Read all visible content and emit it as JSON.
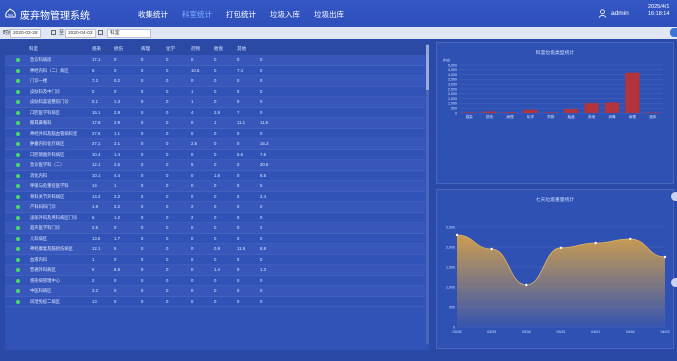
{
  "header": {
    "app_title": "废弃物管理系统",
    "nav": [
      {
        "label": "收集统计",
        "active": false
      },
      {
        "label": "科室统计",
        "active": true
      },
      {
        "label": "打包统计",
        "active": false
      },
      {
        "label": "垃圾入库",
        "active": false
      },
      {
        "label": "垃圾出库",
        "active": false
      }
    ],
    "user": "admin",
    "date": "2025/4/1",
    "time": "16:18:14"
  },
  "filter": {
    "label": "时间:",
    "start_date": "2020-03-28",
    "separator": "至",
    "end_date": "2020-04-03",
    "dept_select": "科室"
  },
  "table": {
    "columns": [
      "科室",
      "感染",
      "损伤",
      "病理",
      "化学",
      "药物",
      "胎盘",
      "其他",
      "",
      "",
      ""
    ],
    "rows": [
      {
        "name": "急诊科病房",
        "v": [
          "17.1",
          "0",
          "0",
          "0",
          "0",
          "0",
          "0",
          "0"
        ]
      },
      {
        "name": "神经内科（二）病区",
        "v": [
          "6",
          "0",
          "0",
          "0",
          "10.5",
          "0",
          "7.4",
          "0"
        ]
      },
      {
        "name": "门诊一楼",
        "v": [
          "7.2",
          "0.2",
          "0",
          "0",
          "0",
          "0",
          "0",
          "0"
        ]
      },
      {
        "name": "皮肤科及中门诊",
        "v": [
          "0",
          "0",
          "0",
          "0",
          "1",
          "0",
          "0",
          "0"
        ]
      },
      {
        "name": "皮肤科美容整形门诊",
        "v": [
          "0.1",
          "1.3",
          "0",
          "0",
          "1",
          "0",
          "0",
          "0"
        ]
      },
      {
        "name": "口腔医学科病区",
        "v": [
          "15.1",
          "2.9",
          "0",
          "0",
          "4",
          "2.5",
          "7",
          "0"
        ]
      },
      {
        "name": "眼耳鼻喉科",
        "v": [
          "17.8",
          "2.9",
          "0",
          "0",
          "0",
          "1",
          "11.1",
          "11.5"
        ]
      },
      {
        "name": "神经外科及脑血管病科室",
        "v": [
          "27.6",
          "1.1",
          "0",
          "0",
          "0",
          "0",
          "0",
          "0"
        ]
      },
      {
        "name": "肿瘤内科化疗病区",
        "v": [
          "27.1",
          "2.1",
          "0",
          "0",
          "2.5",
          "0",
          "0",
          "16.3"
        ]
      },
      {
        "name": "口腔颌面外科病区",
        "v": [
          "10.4",
          "1.4",
          "0",
          "0",
          "0",
          "0",
          "5.6",
          "7.6"
        ]
      },
      {
        "name": "急诊医学科（二）",
        "v": [
          "12.1",
          "2.5",
          "0",
          "0",
          "6",
          "0",
          "0",
          "20.6"
        ]
      },
      {
        "name": "消化内科",
        "v": [
          "10.1",
          "4.4",
          "0",
          "0",
          "0",
          "1.6",
          "0",
          "8.5"
        ]
      },
      {
        "name": "呼吸与危重症医学科",
        "v": [
          "14",
          "1",
          "0",
          "0",
          "0",
          "0",
          "0",
          "5"
        ]
      },
      {
        "name": "骨科关节外科病区",
        "v": [
          "14.2",
          "2.2",
          "0",
          "0",
          "0",
          "0",
          "0",
          "2.4"
        ]
      },
      {
        "name": "产科妇科门诊",
        "v": [
          "1.9",
          "2.2",
          "0",
          "0",
          "2",
          "0",
          "0",
          "0"
        ]
      },
      {
        "name": "泌尿外科及男科病区门诊",
        "v": [
          "6",
          "1.2",
          "0",
          "0",
          "2",
          "0",
          "0",
          "0"
        ]
      },
      {
        "name": "超声医学科门诊",
        "v": [
          "2.5",
          "0",
          "0",
          "0",
          "0",
          "0",
          "0",
          "2"
        ]
      },
      {
        "name": "儿科病区",
        "v": [
          "13.6",
          "1.7",
          "0",
          "0",
          "0",
          "0",
          "0",
          "0"
        ]
      },
      {
        "name": "神经康复及脑损伤病区",
        "v": [
          "12.1",
          "5",
          "0",
          "0",
          "0",
          "0.9",
          "11.9",
          "8.8"
        ]
      },
      {
        "name": "血液内科",
        "v": [
          "1",
          "0",
          "0",
          "0",
          "0",
          "0",
          "0",
          "0"
        ]
      },
      {
        "name": "普通外科病区",
        "v": [
          "6",
          "6.6",
          "0",
          "0",
          "0",
          "1.4",
          "0",
          "1.3"
        ]
      },
      {
        "name": "感染病管理中心",
        "v": [
          "2",
          "0",
          "0",
          "0",
          "0",
          "0",
          "0",
          "0"
        ]
      },
      {
        "name": "中医科病区",
        "v": [
          "3.2",
          "0",
          "0",
          "0",
          "0",
          "0",
          "0",
          "0"
        ]
      },
      {
        "name": "风湿免疫二病区",
        "v": [
          "13",
          "0",
          "0",
          "0",
          "0",
          "0",
          "0",
          "0"
        ]
      }
    ]
  },
  "chart_data": [
    {
      "type": "bar",
      "title": "科室垃圾类型统计",
      "ylabel": "(kg)",
      "categories": [
        "感染",
        "损伤",
        "病理",
        "化学",
        "药物",
        "胎盘",
        "其他",
        "消毒",
        "病理",
        "遗体"
      ],
      "values": [
        10,
        150,
        80,
        330,
        20,
        420,
        1020,
        1100,
        4200,
        10
      ],
      "ylim": [
        0,
        5000
      ],
      "yticks": [
        "5,000",
        "4,500",
        "4,000",
        "3,500",
        "3,000",
        "2,500",
        "2,000",
        "1,500",
        "1,000",
        "500",
        "0"
      ],
      "color": "#b3343d"
    },
    {
      "type": "area",
      "title": "七天垃圾重量统计",
      "x": [
        "03/28",
        "03/29",
        "03/30",
        "03/31",
        "04/01",
        "04/02",
        "04/03"
      ],
      "values": [
        2300,
        1950,
        1050,
        1980,
        2100,
        2200,
        1750
      ],
      "ylim": [
        0,
        2500
      ],
      "yticks": [
        "2,500",
        "2,000",
        "1,500",
        "1,000",
        "500",
        "0"
      ],
      "color": "#d4a14a"
    }
  ]
}
